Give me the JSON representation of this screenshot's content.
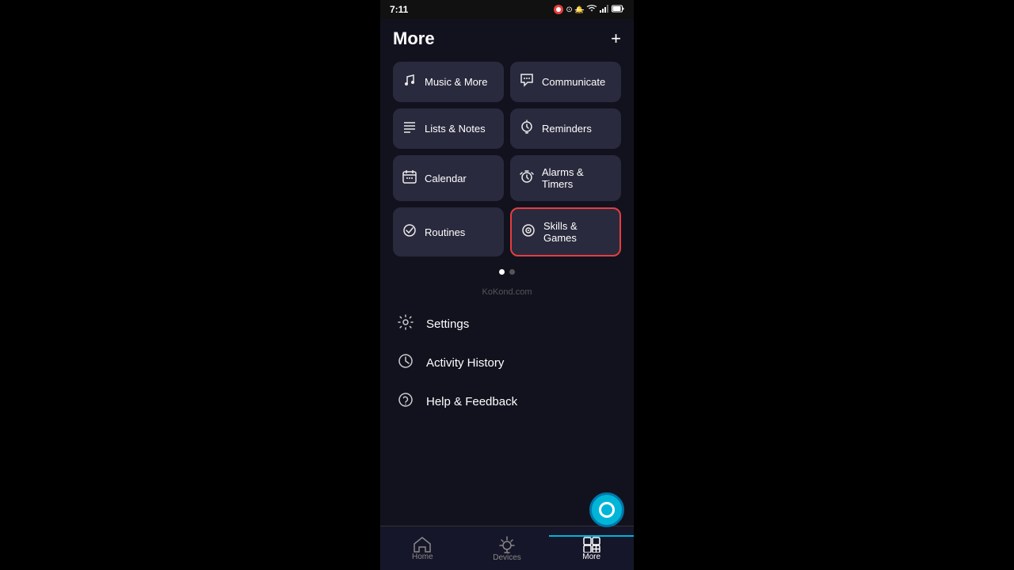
{
  "statusBar": {
    "time": "7:11",
    "icons": [
      "record",
      "mute",
      "wifi",
      "signal",
      "battery"
    ]
  },
  "header": {
    "title": "More",
    "addButton": "+"
  },
  "cards": [
    {
      "id": "music-more",
      "label": "Music & More",
      "icon": "♪",
      "highlighted": false
    },
    {
      "id": "communicate",
      "label": "Communicate",
      "icon": "💬",
      "highlighted": false
    },
    {
      "id": "lists-notes",
      "label": "Lists & Notes",
      "icon": "≡",
      "highlighted": false
    },
    {
      "id": "reminders",
      "label": "Reminders",
      "icon": "⏰",
      "highlighted": false
    },
    {
      "id": "calendar",
      "label": "Calendar",
      "icon": "📅",
      "highlighted": false
    },
    {
      "id": "alarms-timers",
      "label": "Alarms & Timers",
      "icon": "💬",
      "highlighted": false
    },
    {
      "id": "routines",
      "label": "Routines",
      "icon": "✓",
      "highlighted": false
    },
    {
      "id": "skills-games",
      "label": "Skills & Games",
      "icon": "◎",
      "highlighted": true
    }
  ],
  "pagination": [
    {
      "active": true
    },
    {
      "active": false
    }
  ],
  "watermark": "KoKond.com",
  "menuItems": [
    {
      "id": "settings",
      "label": "Settings",
      "icon": "⚙"
    },
    {
      "id": "activity-history",
      "label": "Activity History",
      "icon": "◷"
    },
    {
      "id": "help-feedback",
      "label": "Help & Feedback",
      "icon": "?"
    }
  ],
  "bottomNav": [
    {
      "id": "home",
      "label": "Home",
      "icon": "⌂",
      "active": false
    },
    {
      "id": "devices",
      "label": "Devices",
      "icon": "💡",
      "active": false
    },
    {
      "id": "more",
      "label": "More",
      "icon": "⊞",
      "active": true
    }
  ]
}
